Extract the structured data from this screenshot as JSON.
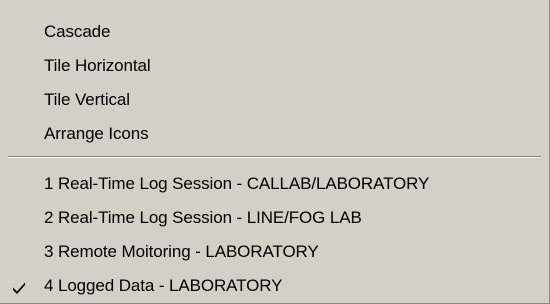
{
  "menu": {
    "window_items": [
      {
        "label": "Cascade"
      },
      {
        "label": "Tile Horizontal"
      },
      {
        "label": "Tile Vertical"
      },
      {
        "label": "Arrange Icons"
      }
    ],
    "document_items": [
      {
        "label": "1 Real-Time Log Session - CALLAB/LABORATORY",
        "checked": false
      },
      {
        "label": "2 Real-Time Log Session - LINE/FOG LAB",
        "checked": false
      },
      {
        "label": "3 Remote Moitoring - LABORATORY",
        "checked": false
      },
      {
        "label": "4 Logged Data - LABORATORY",
        "checked": true
      }
    ],
    "check_icon": "checkmark-icon",
    "background_color": "#d4d0c8"
  }
}
